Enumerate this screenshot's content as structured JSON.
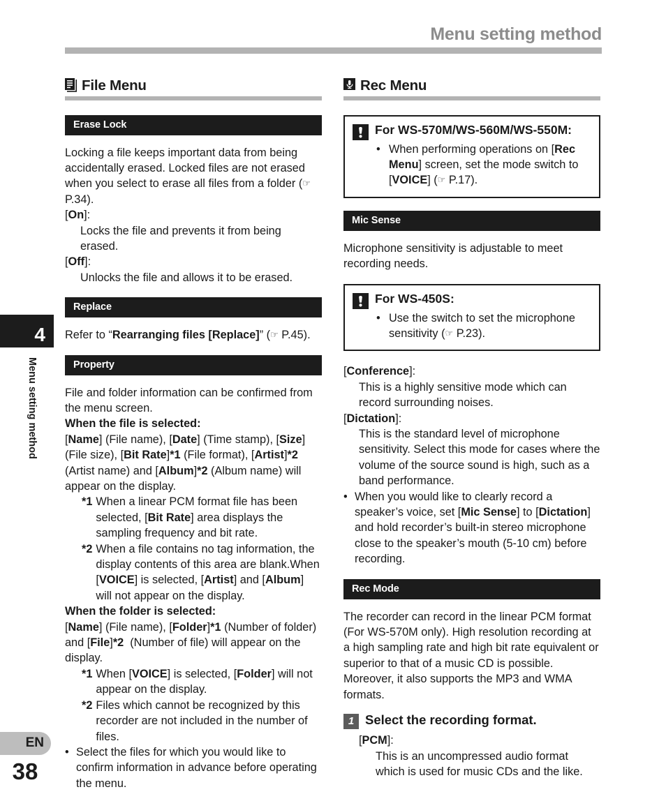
{
  "header": {
    "title": "Menu setting method"
  },
  "sidebar": {
    "chapter_number": "4",
    "chapter_title": "Menu setting method",
    "language_badge": "EN",
    "page_number": "38"
  },
  "icons": {
    "file_menu": "file-document-icon",
    "rec_menu": "microphone-icon",
    "caution": "exclamation-icon",
    "reference": "pointing-hand-icon"
  },
  "ref_symbol": "☞",
  "left_column": {
    "menu_title": "File Menu",
    "sections": [
      {
        "bar": "Erase Lock",
        "paragraph": "Locking a file keeps important data from being accidentally erased. Locked files are not erased when you select to erase all files from a folder (",
        "paragraph_ref": " P.34).",
        "on_label": "[On]:",
        "on_label_plain": "On",
        "on_desc": "Locks the file and prevents it from being erased.",
        "off_label_plain": "Off",
        "off_desc": "Unlocks the file and allows it to be erased."
      },
      {
        "bar": "Replace",
        "refer_prefix": "Refer to “",
        "refer_bold": "Rearranging files [Replace]",
        "refer_suffix": "” (",
        "refer_page": " P.45)."
      },
      {
        "bar": "Property",
        "intro": "File and folder information can be confirmed from the menu screen.",
        "file_selected_heading": "When the file is selected:",
        "file_selected_body": "[Name] (File name), [Date] (Time stamp), [Size] (File size), [Bit Rate]*1 (File format), [Artist]*2 (Artist name) and [Album]*2 (Album name) will appear on the display.",
        "notes_file": [
          {
            "mark": "*1",
            "text": "When a linear PCM format file has been selected, [Bit Rate] area displays the sampling frequency and bit rate."
          },
          {
            "mark": "*2",
            "text": "When a file contains no tag information, the display contents of this area are blank.When [VOICE] is selected, [Artist] and [Album] will not appear on the display."
          }
        ],
        "folder_selected_heading": "When the folder is selected:",
        "folder_selected_body": "[Name] (File name), [Folder]*1 (Number of folder) and [File]*2  (Number of file) will appear on the display.",
        "notes_folder": [
          {
            "mark": "*1",
            "text": "When [VOICE] is selected, [Folder] will not appear on the display."
          },
          {
            "mark": "*2",
            "text": "Files which cannot be recognized by this recorder are not included in the number of files."
          }
        ],
        "bullet": "Select the files for which you would like to confirm information in advance before operating the menu."
      }
    ]
  },
  "right_column": {
    "menu_title": "Rec Menu",
    "caution_1": {
      "title": "For WS-570M/WS-560M/WS-550M:",
      "bullets_pre": "When performing operations on [",
      "bullets": [
        "When performing operations on [Rec Menu] screen, set the mode switch to [VOICE] ( P.17)."
      ]
    },
    "mic_sense": {
      "bar": "Mic Sense",
      "intro": "Microphone sensitivity is adjustable to meet recording needs.",
      "caution_2_title": "For WS-450S:",
      "caution_2_bullet": "Use the switch to set the microphone sensitivity ( P.23).",
      "conference_label": "Conference",
      "conference_desc": "This is a highly sensitive mode which can record surrounding noises.",
      "dictation_label": "Dictation",
      "dictation_desc": "This is the standard level of microphone sensitivity. Select this mode for cases where the volume of the source sound is high, such as a band performance.",
      "bullet": "When you would like to clearly record a speaker’s voice, set [Mic Sense] to [Dictation] and hold recorder’s built-in stereo microphone close to the speaker’s mouth (5-10 cm) before recording."
    },
    "rec_mode": {
      "bar": "Rec Mode",
      "intro": "The recorder can record in the linear PCM format (For WS-570M only). High resolution recording at a high sampling rate and high bit rate equivalent or superior to that of a music CD is possible. Moreover, it also supports the MP3 and WMA formats.",
      "step_number": "1",
      "step_title": "Select the recording format.",
      "pcm_label": "PCM",
      "pcm_desc": "This is an uncompressed audio format which is used for music CDs and the like."
    }
  },
  "colors": {
    "bar_black": "#1c1c1c",
    "rule_gray": "#b3b3b3",
    "header_gray": "#8c8c8c",
    "step_badge_gray": "#5b5b5b",
    "lang_badge_gray": "#bdbdbd"
  }
}
